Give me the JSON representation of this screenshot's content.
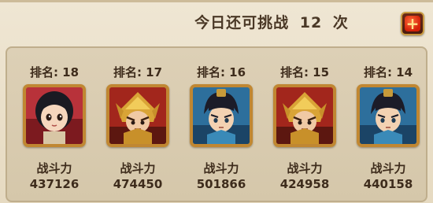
{
  "header": {
    "challenge_prefix": "今日还可挑战",
    "challenge_count": "12",
    "challenge_suffix": "次",
    "add_button": "+"
  },
  "players": [
    {
      "rank_label": "排名:",
      "rank": "18",
      "power_label": "战斗力",
      "power": "437126",
      "avatar": "girl-black-hair-icon",
      "bg": "#b8323a"
    },
    {
      "rank_label": "排名:",
      "rank": "17",
      "power_label": "战斗力",
      "power": "474450",
      "avatar": "golden-helmet-warrior-icon",
      "bg": "#a2261c"
    },
    {
      "rank_label": "排名:",
      "rank": "16",
      "power_label": "战斗力",
      "power": "501866",
      "avatar": "blue-scholar-warrior-icon",
      "bg": "#2d6f9c"
    },
    {
      "rank_label": "排名:",
      "rank": "15",
      "power_label": "战斗力",
      "power": "424958",
      "avatar": "golden-helmet-warrior-icon",
      "bg": "#a2261c"
    },
    {
      "rank_label": "排名:",
      "rank": "14",
      "power_label": "战斗力",
      "power": "440158",
      "avatar": "blue-scholar-warrior-icon",
      "bg": "#2d6f9c"
    }
  ]
}
